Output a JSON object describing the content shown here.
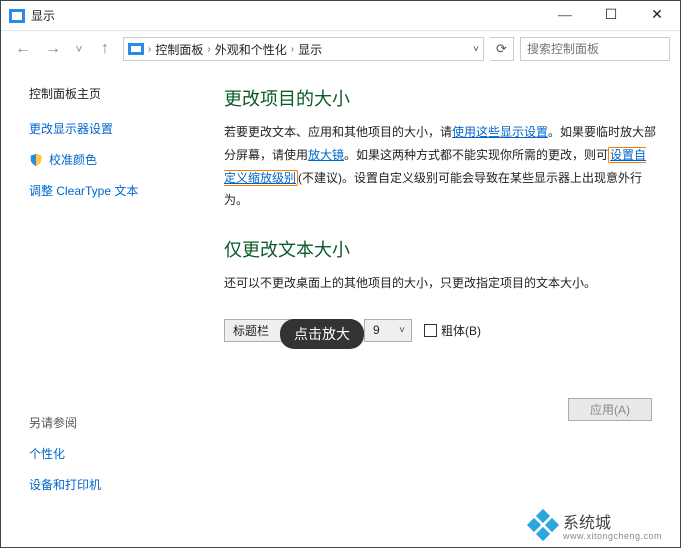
{
  "window": {
    "title": "显示"
  },
  "nav": {
    "breadcrumb": [
      "控制面板",
      "外观和个性化",
      "显示"
    ],
    "search_placeholder": "搜索控制面板"
  },
  "sidebar": {
    "home": "控制面板主页",
    "links": [
      "更改显示器设置",
      "校准颜色",
      "调整 ClearType 文本"
    ],
    "see_also_header": "另请参阅",
    "see_also": [
      "个性化",
      "设备和打印机"
    ]
  },
  "main": {
    "heading1": "更改项目的大小",
    "para1_pre": "若要更改文本、应用和其他项目的大小，请",
    "para1_link1": "使用这些显示设置",
    "para1_mid1": "。如果要临时放大部分屏幕，请使用",
    "para1_link2": "放大镜",
    "para1_mid2": "。如果这两种方式都不能实现你所需的更改，则可",
    "para1_link3": "设置自定义缩放级别",
    "para1_tail": "(不建议)。设置自定义级别可能会导致在某些显示器上出现意外行为。",
    "heading2": "仅更改文本大小",
    "para2": "还可以不更改桌面上的其他项目的大小，只更改指定项目的文本大小。",
    "tooltip": "点击放大",
    "select_value": "标题栏",
    "fontsize_value": "9",
    "bold_label": "粗体(B)",
    "apply_label": "应用(A)"
  },
  "watermark": {
    "brand": "系统城",
    "url": "www.xitongcheng.com"
  }
}
